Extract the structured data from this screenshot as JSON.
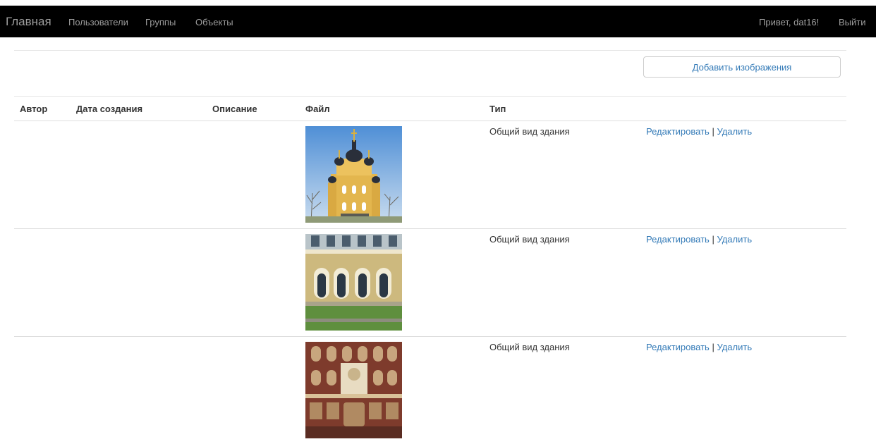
{
  "navbar": {
    "brand": "Главная",
    "links": [
      "Пользователи",
      "Группы",
      "Объекты"
    ],
    "greeting": "Привет, dat16!",
    "logout": "Выйти"
  },
  "toolbar": {
    "add_images_label": "Добавить изображения"
  },
  "table": {
    "columns": [
      "Автор",
      "Дата создания",
      "Описание",
      "Файл",
      "Тип"
    ],
    "rows": [
      {
        "author": "",
        "created": "",
        "description": "",
        "type": "Общий вид здания",
        "edit": "Редактировать",
        "separator": "|",
        "delete": "Удалить"
      },
      {
        "author": "",
        "created": "",
        "description": "",
        "type": "Общий вид здания",
        "edit": "Редактировать",
        "separator": "|",
        "delete": "Удалить"
      },
      {
        "author": "",
        "created": "",
        "description": "",
        "type": "Общий вид здания",
        "edit": "Редактировать",
        "separator": "|",
        "delete": "Удалить"
      }
    ]
  },
  "colors": {
    "navbar_bg": "#000000",
    "nav_text": "#9d9d9d",
    "link": "#337ab7",
    "border": "#dddddd"
  }
}
